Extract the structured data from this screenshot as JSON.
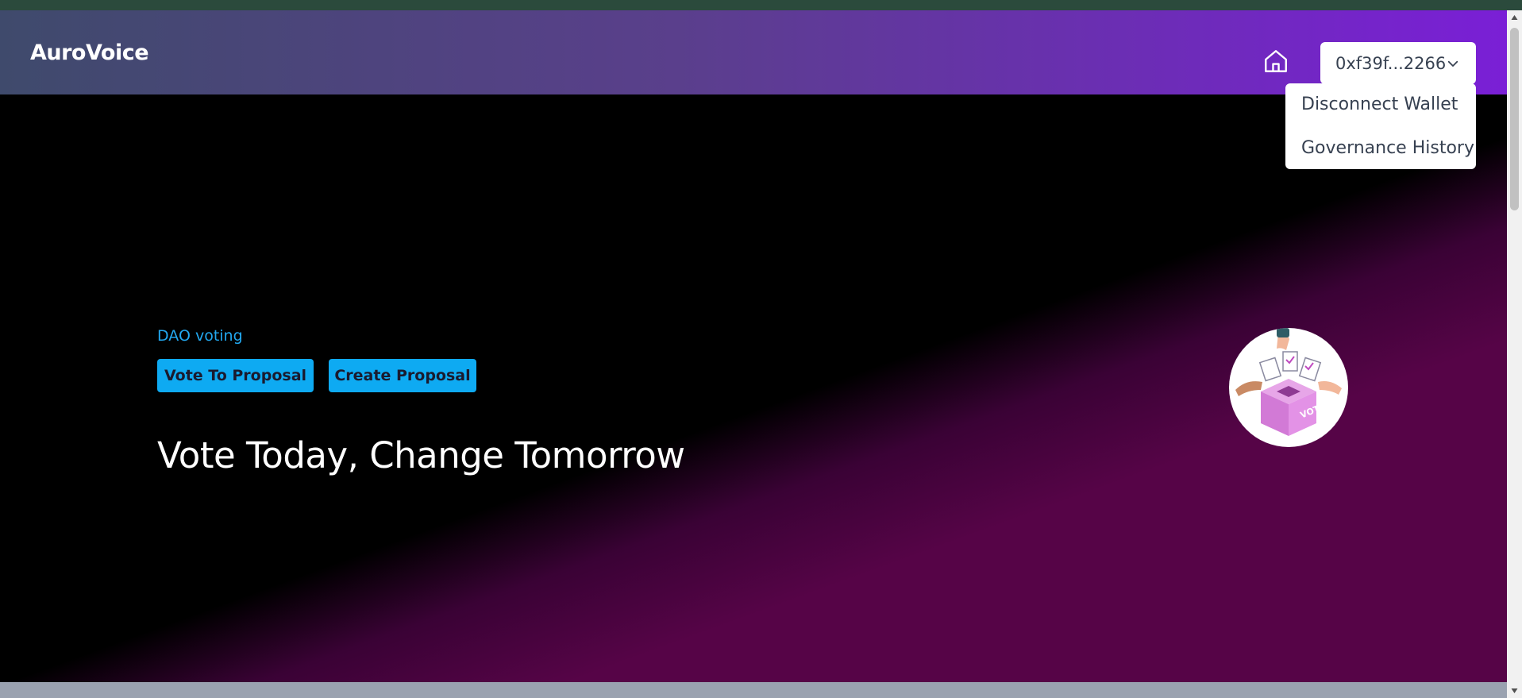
{
  "navbar": {
    "brand": "AuroVoice",
    "home_icon": "home-icon",
    "wallet_label": "0xf39f...2266",
    "wallet_chevron_icon": "chevron-down-icon"
  },
  "dropdown": {
    "items": [
      {
        "label": "Disconnect Wallet"
      },
      {
        "label": "Governance History"
      }
    ]
  },
  "hero": {
    "eyebrow": "DAO voting",
    "buttons": {
      "vote": "Vote To Proposal",
      "create": "Create Proposal"
    },
    "headline": "Vote Today, Change Tomorrow",
    "illustration_label": "VOTE"
  },
  "colors": {
    "accent": "#0eaaf2",
    "eyebrow": "#22a8f0",
    "nav_gradient_start": "#3f4a6c",
    "nav_gradient_end": "#7a1fd6",
    "hero_magenta": "#560447"
  }
}
